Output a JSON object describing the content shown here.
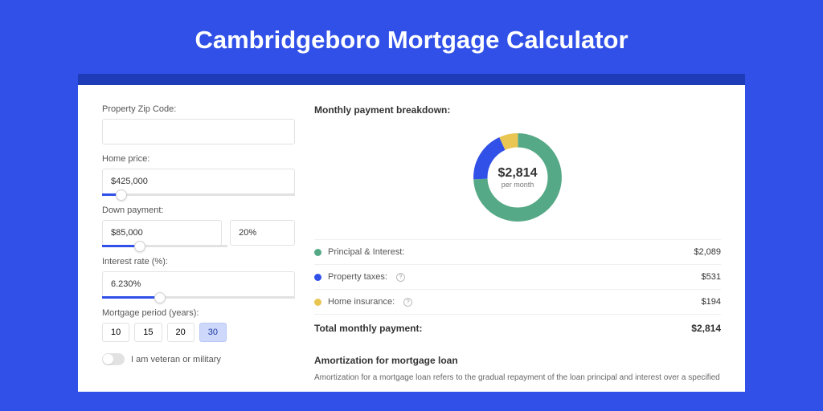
{
  "title": "Cambridgeboro Mortgage Calculator",
  "colors": {
    "principal": "#55a986",
    "taxes": "#3050e8",
    "insurance": "#e9c551"
  },
  "form": {
    "zip": {
      "label": "Property Zip Code:",
      "value": "",
      "placeholder": ""
    },
    "price": {
      "label": "Home price:",
      "value": "$425,000",
      "slider_pct": 10
    },
    "down": {
      "label": "Down payment:",
      "value": "$85,000",
      "pct_value": "20%",
      "slider_pct": 20
    },
    "rate": {
      "label": "Interest rate (%):",
      "value": "6.230%",
      "slider_pct": 30
    },
    "period": {
      "label": "Mortgage period (years):",
      "options": [
        "10",
        "15",
        "20",
        "30"
      ],
      "selected": "30"
    },
    "veteran": {
      "label": "I am veteran or military",
      "value": false
    }
  },
  "breakdown": {
    "title": "Monthly payment breakdown:",
    "center_amount": "$2,814",
    "center_sub": "per month",
    "items": [
      {
        "label": "Principal & Interest:",
        "value": "$2,089",
        "color": "#55a986",
        "help": false
      },
      {
        "label": "Property taxes:",
        "value": "$531",
        "color": "#3050e8",
        "help": true
      },
      {
        "label": "Home insurance:",
        "value": "$194",
        "color": "#e9c551",
        "help": true
      }
    ],
    "total": {
      "label": "Total monthly payment:",
      "value": "$2,814"
    }
  },
  "amortization": {
    "title": "Amortization for mortgage loan",
    "text": "Amortization for a mortgage loan refers to the gradual repayment of the loan principal and interest over a specified"
  },
  "chart_data": {
    "type": "pie",
    "title": "Monthly payment breakdown",
    "series": [
      {
        "name": "Principal & Interest",
        "value": 2089,
        "color": "#55a986"
      },
      {
        "name": "Property taxes",
        "value": 531,
        "color": "#3050e8"
      },
      {
        "name": "Home insurance",
        "value": 194,
        "color": "#e9c551"
      }
    ],
    "total": 2814,
    "center_label": "$2,814 per month"
  }
}
